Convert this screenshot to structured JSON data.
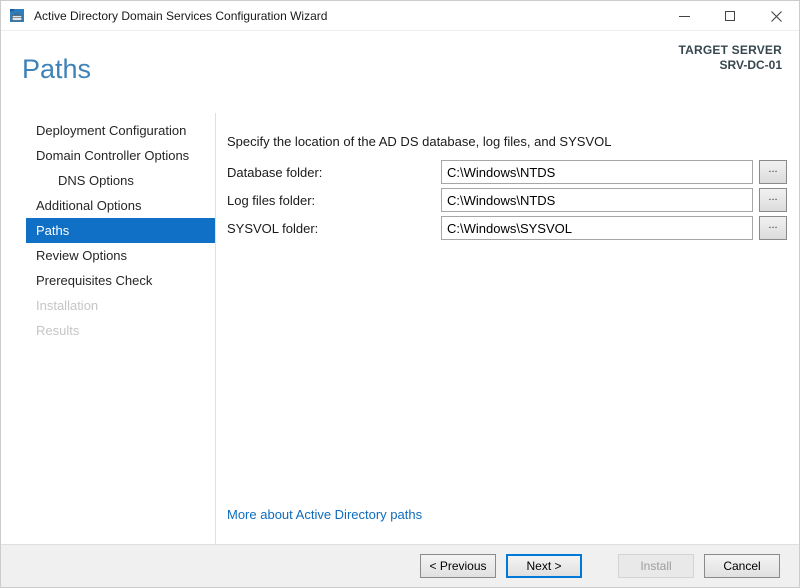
{
  "window": {
    "title": "Active Directory Domain Services Configuration Wizard"
  },
  "header": {
    "title": "Paths",
    "target_server_label": "TARGET SERVER",
    "target_server_name": "SRV-DC-01"
  },
  "sidebar": {
    "items": [
      {
        "label": "Deployment Configuration",
        "state": "normal",
        "indent": 0
      },
      {
        "label": "Domain Controller Options",
        "state": "normal",
        "indent": 0
      },
      {
        "label": "DNS Options",
        "state": "normal",
        "indent": 1
      },
      {
        "label": "Additional Options",
        "state": "normal",
        "indent": 0
      },
      {
        "label": "Paths",
        "state": "selected",
        "indent": 0
      },
      {
        "label": "Review Options",
        "state": "normal",
        "indent": 0
      },
      {
        "label": "Prerequisites Check",
        "state": "normal",
        "indent": 0
      },
      {
        "label": "Installation",
        "state": "disabled",
        "indent": 0
      },
      {
        "label": "Results",
        "state": "disabled",
        "indent": 0
      }
    ]
  },
  "main": {
    "description": "Specify the location of the AD DS database, log files, and SYSVOL",
    "fields": [
      {
        "label": "Database folder:",
        "value": "C:\\Windows\\NTDS",
        "browse_label": "..."
      },
      {
        "label": "Log files folder:",
        "value": "C:\\Windows\\NTDS",
        "browse_label": "..."
      },
      {
        "label": "SYSVOL folder:",
        "value": "C:\\Windows\\SYSVOL",
        "browse_label": "..."
      }
    ],
    "link": "More about Active Directory paths"
  },
  "footer": {
    "buttons": [
      {
        "label": "< Previous",
        "state": "normal"
      },
      {
        "label": "Next >",
        "state": "default"
      },
      {
        "label": "Install",
        "state": "disabled"
      },
      {
        "label": "Cancel",
        "state": "normal"
      }
    ]
  },
  "colors": {
    "accent_selected": "#0f70c6",
    "heading_blue": "#3e82b8",
    "link_blue": "#0f6cbd",
    "default_button_border": "#0078d7",
    "target_server_text": "#37474f",
    "footer_bg": "#f0f0f0"
  }
}
